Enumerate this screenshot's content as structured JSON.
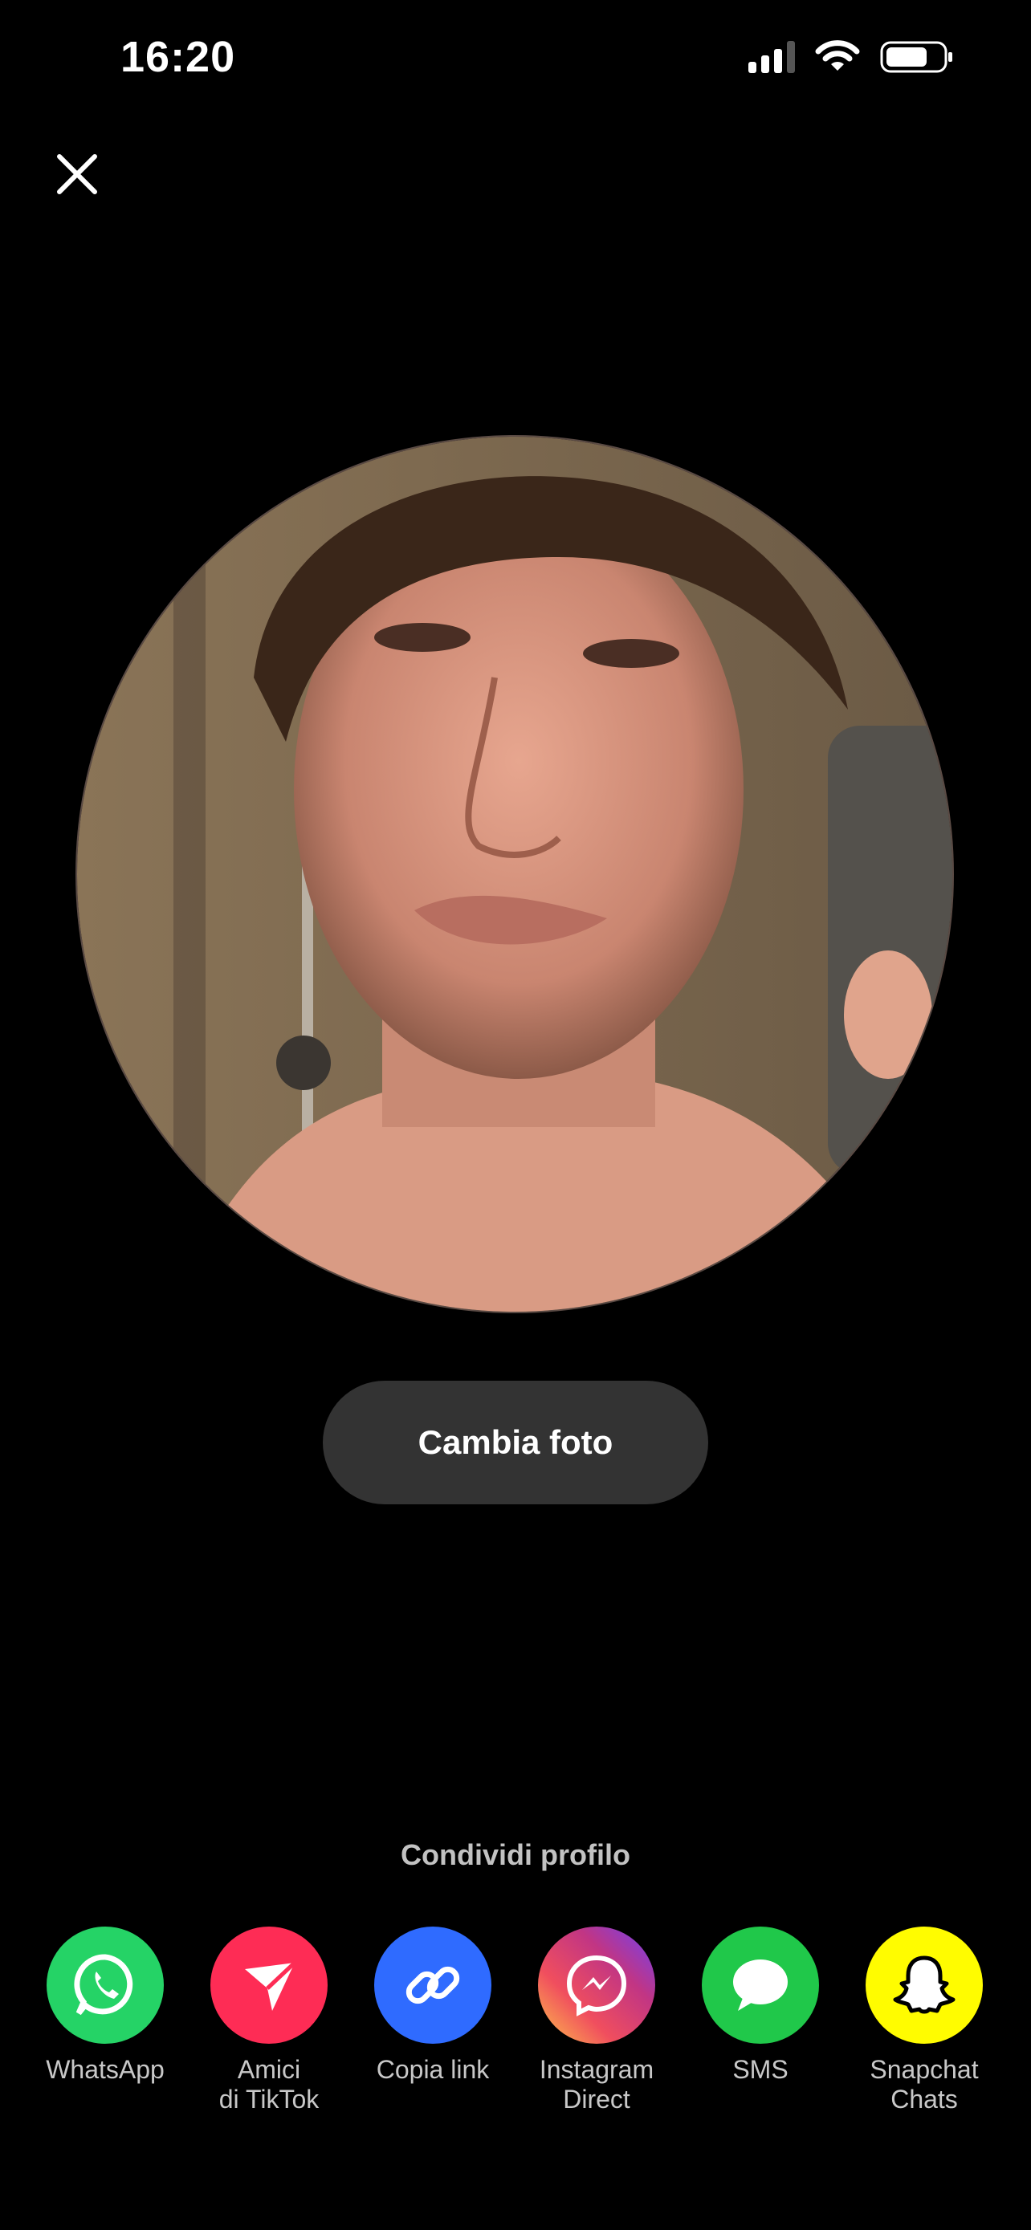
{
  "status_bar": {
    "time": "16:20",
    "icons": [
      "signal-icon",
      "wifi-icon",
      "battery-icon"
    ]
  },
  "header": {
    "close_icon": "close-icon"
  },
  "profile": {
    "change_photo_label": "Cambia foto"
  },
  "share": {
    "title": "Condividi profilo",
    "items": [
      {
        "label": "WhatsApp",
        "icon": "whatsapp-icon",
        "color": "#25D366"
      },
      {
        "label": "Amici\ndi TikTok",
        "icon": "paper-plane-icon",
        "color": "#FE2C55"
      },
      {
        "label": "Copia link",
        "icon": "link-icon",
        "color": "#2F6BFF"
      },
      {
        "label": "Instagram\nDirect",
        "icon": "messenger-icon",
        "color": "#C13584"
      },
      {
        "label": "SMS",
        "icon": "message-bubble-icon",
        "color": "#20C84A"
      },
      {
        "label": "Snapchat\nChats",
        "icon": "snapchat-ghost-icon",
        "color": "#FFFC00"
      }
    ]
  },
  "colors": {
    "background": "#000000",
    "button_bg": "#333333",
    "label_gray": "#C8C8C8"
  }
}
